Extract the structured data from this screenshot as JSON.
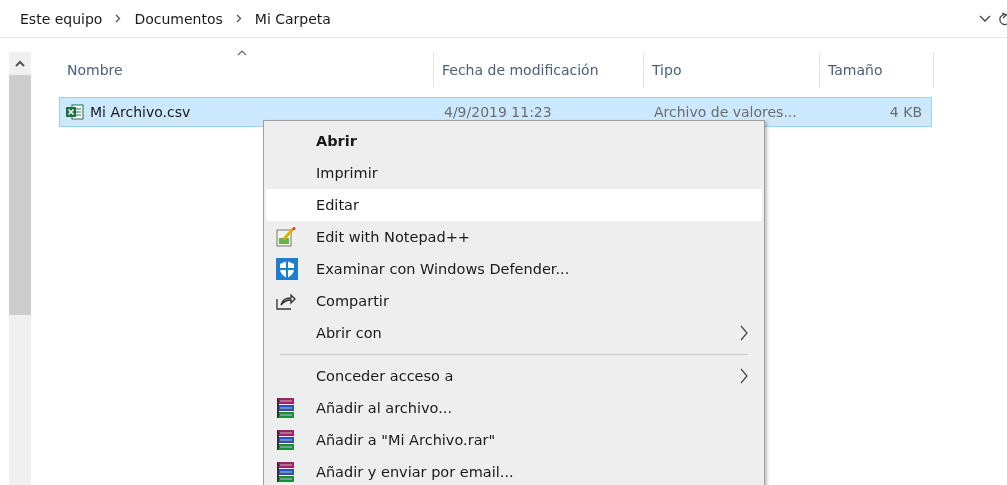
{
  "breadcrumb": [
    "Este equipo",
    "Documentos",
    "Mi Carpeta"
  ],
  "columns": [
    {
      "label": "Nombre",
      "sorted": true
    },
    {
      "label": "Fecha de modificación",
      "sorted": false
    },
    {
      "label": "Tipo",
      "sorted": false
    },
    {
      "label": "Tamaño",
      "sorted": false
    }
  ],
  "files": [
    {
      "name": "Mi Archivo.csv",
      "modified": "4/9/2019 11:23",
      "type": "Archivo de valores...",
      "size": "4 KB",
      "selected": true
    }
  ],
  "context_menu": {
    "groups": [
      [
        {
          "label": "Abrir",
          "bold": true,
          "selected": false,
          "submenu": false
        },
        {
          "label": "Imprimir",
          "bold": false,
          "selected": false,
          "submenu": false
        },
        {
          "label": "Editar",
          "bold": false,
          "selected": true,
          "submenu": false
        },
        {
          "label": "Edit with Notepad++",
          "kind": "notepad",
          "bold": false,
          "selected": false,
          "submenu": false
        },
        {
          "label": "Examinar con Windows Defender...",
          "kind": "shield",
          "bold": false,
          "selected": false,
          "submenu": false
        },
        {
          "label": "Compartir",
          "kind": "share",
          "bold": false,
          "selected": false,
          "submenu": false
        },
        {
          "label": "Abrir con",
          "bold": false,
          "selected": false,
          "submenu": true
        }
      ],
      [
        {
          "label": "Conceder acceso a",
          "bold": false,
          "selected": false,
          "submenu": true
        },
        {
          "label": "Añadir al archivo...",
          "kind": "books",
          "bold": false,
          "selected": false,
          "submenu": false
        },
        {
          "label": "Añadir a \"Mi Archivo.rar\"",
          "kind": "books",
          "bold": false,
          "selected": false,
          "submenu": false
        },
        {
          "label": "Añadir y enviar por email...",
          "kind": "books",
          "bold": false,
          "selected": false,
          "submenu": false
        }
      ]
    ]
  }
}
